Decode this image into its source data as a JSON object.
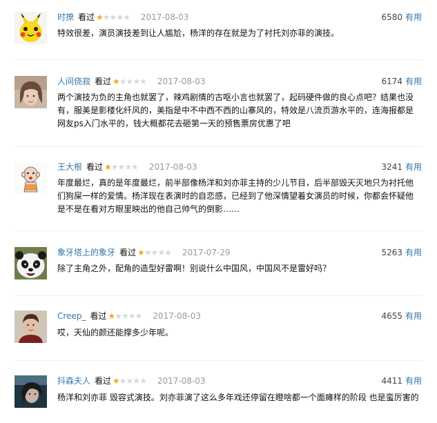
{
  "reviews": [
    {
      "user": "时撩",
      "verb": "看过",
      "rating_stars": 1,
      "date": "2017-08-03",
      "votes": "6580",
      "useful_label": "有用",
      "avatar": "pikachu-avatar",
      "lines": [
        "特效很差，演员演技差到让人尴尬，杨洋的存在就是为了衬托刘亦菲的演技。"
      ]
    },
    {
      "user": "人间侥寂",
      "verb": "看过",
      "rating_stars": 1,
      "date": "2017-08-03",
      "votes": "6174",
      "useful_label": "有用",
      "avatar": "girl-portrait-avatar",
      "lines": [
        "两个演技为负的主角也就罢了，辣鸡剧情的古呕小言也就罢了，起码硬件做的良心点吧？结果也没",
        "有，服美是影楼化纤风的，美指是中不中西不西的山寨风的，特效是八流页游水平的，连海报都是",
        "网友ps入门水平的，钱大概都花去砸第一天的预售票房优惠了吧"
      ]
    },
    {
      "user": "王大根",
      "verb": "看过",
      "rating_stars": 1,
      "date": "2017-08-03",
      "votes": "3241",
      "useful_label": "有用",
      "avatar": "cartoon-bald-avatar",
      "lines": [
        "年度最烂，真的是年度最烂，前半部像杨洋和刘亦菲主持的少儿节目，后半部毁天灭地只为衬托他",
        "们狗屎一样的爱情。杨洋现在表演时的自恋感，已经到了他深情望着女演员的时候，你都会怀疑他",
        "是不是在看对方眼里映出的他自己帅气的倒影……"
      ]
    },
    {
      "user": "象牙塔上的象牙",
      "verb": "看过",
      "rating_stars": 1,
      "date": "2017-07-29",
      "votes": "5263",
      "useful_label": "有用",
      "avatar": "panda-avatar",
      "lines": [
        "除了主角之外，配角的造型好雷啊！别说什么中国风，中国风不是雷好吗？"
      ]
    },
    {
      "user": "Creep_",
      "verb": "看过",
      "rating_stars": 1,
      "date": "2017-08-03",
      "votes": "4655",
      "useful_label": "有用",
      "avatar": "young-man-avatar",
      "lines": [
        "哎，天仙的颜还能撑多少年呢。"
      ]
    },
    {
      "user": "抖森夫人",
      "verb": "看过",
      "rating_stars": 1,
      "date": "2017-08-03",
      "votes": "4411",
      "useful_label": "有用",
      "avatar": "dark-portrait-avatar",
      "lines": [
        "杨洋和刘亦菲 毁容式演技。刘亦菲演了这么多年戏还停留在瞪啥都一个面瘫样的阶段 也是蛮厉害的"
      ]
    }
  ],
  "colors": {
    "link": "#3377aa",
    "star_on": "#f5a623",
    "star_off": "#d8d8d8",
    "date": "#999999"
  }
}
